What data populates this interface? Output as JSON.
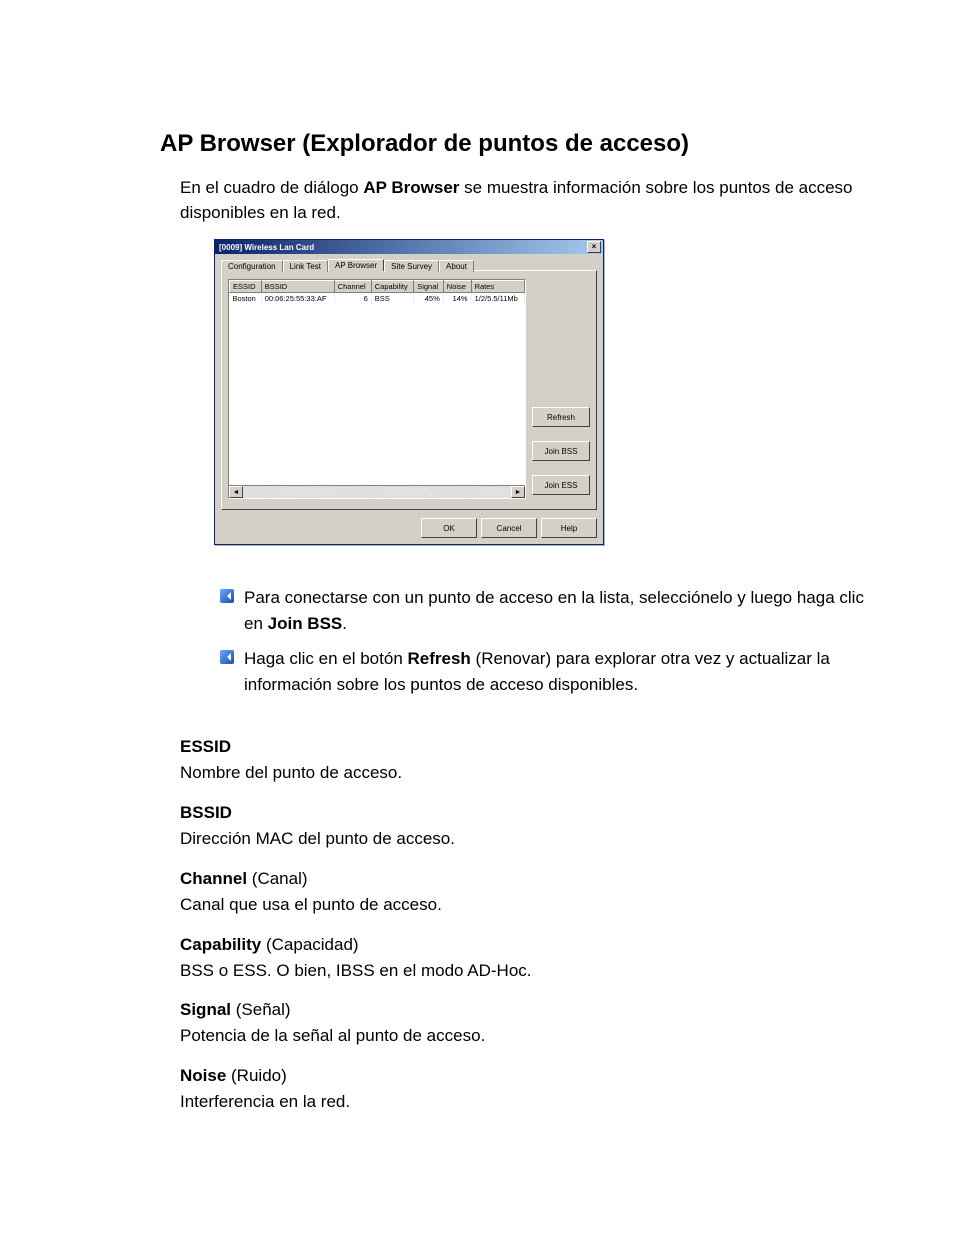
{
  "heading": "AP Browser (Explorador de puntos de acceso)",
  "intro_pre": "En el cuadro de diálogo ",
  "intro_bold": "AP Browser",
  "intro_post": " se muestra información sobre los puntos de acceso disponibles en la red.",
  "dialog": {
    "title": "[0009] Wireless Lan Card",
    "tabs": {
      "configuration": "Configuration",
      "link_test": "Link Test",
      "ap_browser": "AP Browser",
      "site_survey": "Site Survey",
      "about": "About"
    },
    "columns": {
      "essid": "ESSID",
      "bssid": "BSSID",
      "channel": "Channel",
      "capability": "Capability",
      "signal": "Signal",
      "noise": "Noise",
      "rates": "Rates"
    },
    "row": {
      "essid": "Boston",
      "bssid": "00:06:25:55:33:AF",
      "channel": "6",
      "capability": "BSS",
      "signal": "45%",
      "noise": "14%",
      "rates": "1/2/5.5/11Mb"
    },
    "buttons": {
      "refresh": "Refresh",
      "join_bss": "Join BSS",
      "join_ess": "Join ESS",
      "ok": "OK",
      "cancel": "Cancel",
      "help": "Help"
    }
  },
  "bullets": {
    "b1_pre": "Para conectarse con un punto de acceso en la lista, selecciónelo y luego haga clic en ",
    "b1_bold": "Join BSS",
    "b1_post": ".",
    "b2_pre": "Haga clic en el botón ",
    "b2_bold": "Refresh",
    "b2_post": " (Renovar) para explorar otra vez y actualizar la información sobre los puntos de acceso disponibles."
  },
  "definitions": {
    "essid_term": "ESSID",
    "essid_desc": "Nombre del punto de acceso.",
    "bssid_term": "BSSID",
    "bssid_desc": "Dirección MAC del punto de acceso.",
    "channel_bold": "Channel",
    "channel_paren": " (Canal)",
    "channel_desc": "Canal que usa el punto de acceso.",
    "capability_bold": "Capability",
    "capability_paren": " (Capacidad)",
    "capability_desc": "BSS o ESS. O bien, IBSS en el modo AD-Hoc.",
    "signal_bold": "Signal",
    "signal_paren": " (Señal)",
    "signal_desc": "Potencia de la señal al punto de acceso.",
    "noise_bold": "Noise",
    "noise_paren": " (Ruido)",
    "noise_desc": "Interferencia en la red."
  }
}
